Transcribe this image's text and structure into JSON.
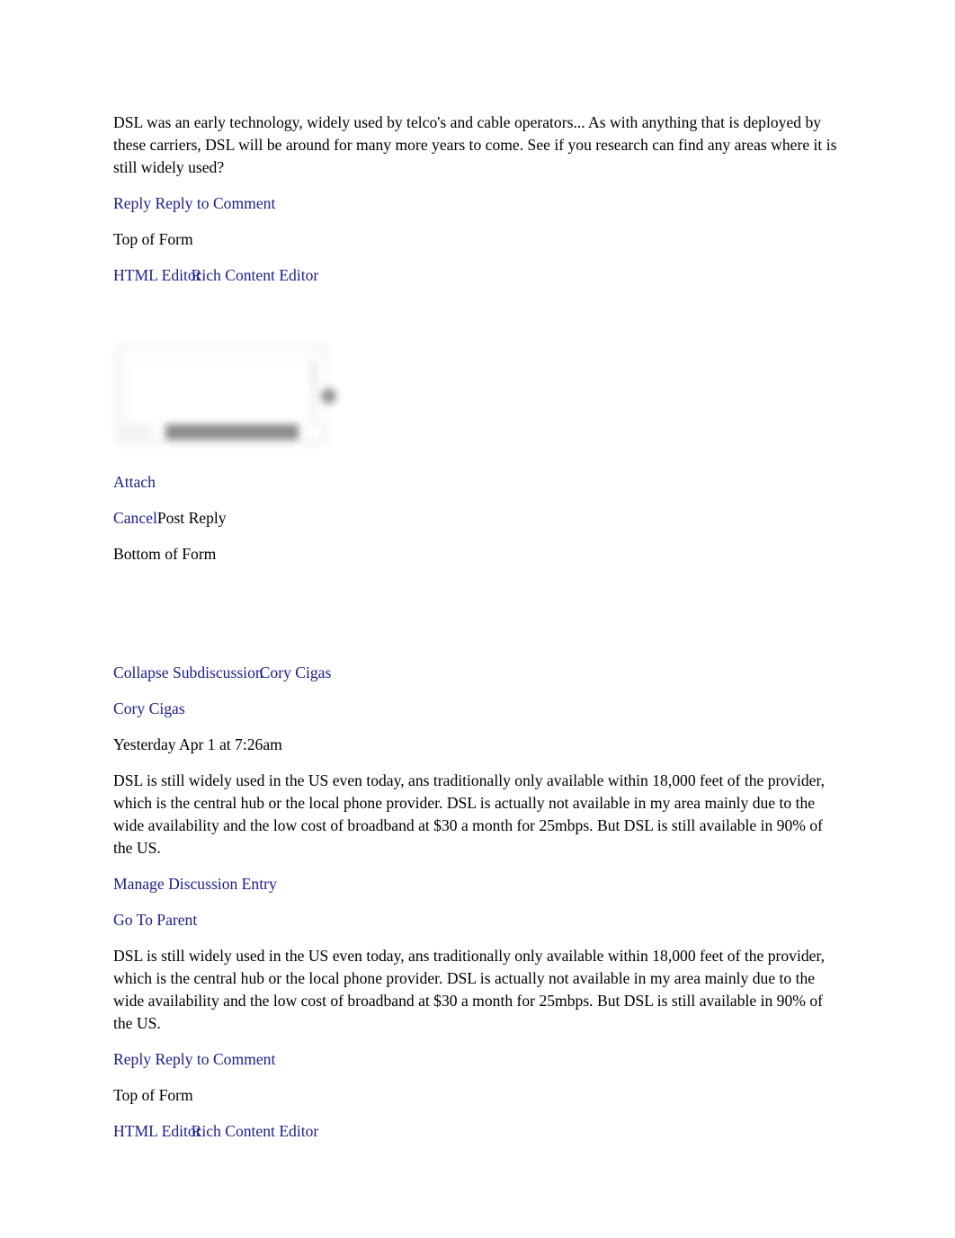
{
  "document": {
    "type": "discussion-thread-export",
    "link_color": "#1c1c8f",
    "text_color": "#000000",
    "background": "#ffffff"
  },
  "instructor_comment": {
    "body": "DSL was an early technology, widely used by telco's and cable operators... As with anything that is deployed by these carriers, DSL will be around for many more years to come. See if you research can find any areas where it is still widely used?"
  },
  "reply_bar_top": {
    "reply_label": "Reply",
    "reply_to_comment_label": "Reply to Comment"
  },
  "form_top": {
    "top_of_form_label": "Top of Form",
    "html_editor_label": "HTML Editor",
    "rich_content_editor_label": "Rich Content Editor",
    "attach_label": "Attach",
    "cancel_label": "Cancel",
    "post_reply_label": "Post Reply",
    "bottom_of_form_label": "Bottom of Form",
    "editor_placeholder": ""
  },
  "subdiscussion": {
    "collapse_label": "Collapse Subdiscussion",
    "author_link_inline": "Cory Cigas",
    "author_link": "Cory Cigas",
    "timestamp": "Yesterday Apr 1 at 7:26am",
    "message": "DSL is still widely used in the US even today, ans traditionally only available within 18,000 feet of the provider, which is the central hub or the local phone provider. DSL is actually not available in my area mainly due to the wide availability and the low cost of broadband at $30 a month for 25mbps. But DSL is still available in 90% of the US.",
    "manage_entry_label": "Manage Discussion Entry",
    "go_to_parent_label": "Go To Parent",
    "quoted_message": "DSL is still widely used in the US even today, ans traditionally only available within 18,000 feet of the provider, which is the central hub or the local phone provider. DSL is actually not available in my area mainly due to the wide availability and the low cost of broadband at $30 a month for 25mbps. But DSL is still available in 90% of the US."
  },
  "reply_bar_bottom": {
    "reply_label": "Reply",
    "reply_to_comment_label": "Reply to Comment"
  },
  "form_bottom": {
    "top_of_form_label": "Top of Form",
    "html_editor_label": "HTML Editor",
    "rich_content_editor_label": "Rich Content Editor"
  }
}
